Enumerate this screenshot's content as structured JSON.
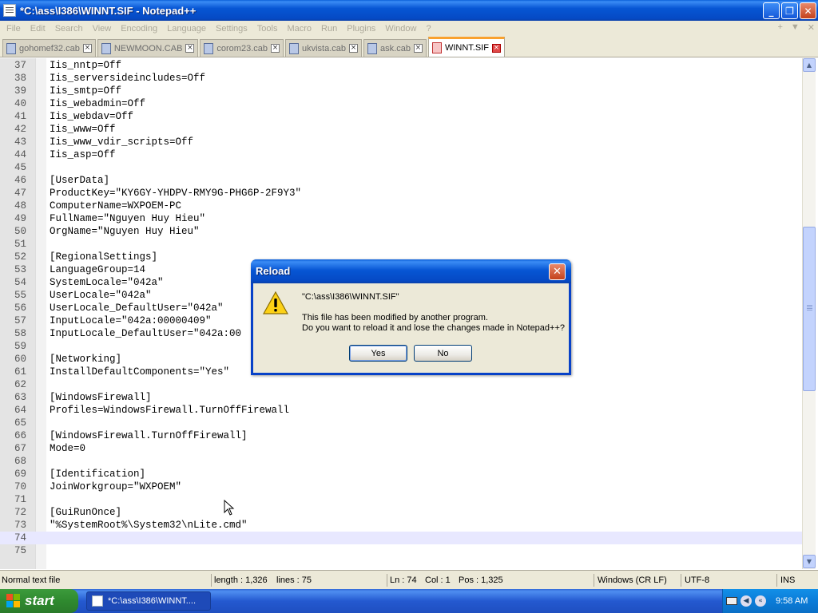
{
  "window": {
    "title": "*C:\\ass\\I386\\WINNT.SIF - Notepad++",
    "minimize_glyph": "_",
    "maximize_glyph": "❐",
    "close_glyph": "✕"
  },
  "menu": {
    "items": [
      "File",
      "Edit",
      "Search",
      "View",
      "Encoding",
      "Language",
      "Settings",
      "Tools",
      "Macro",
      "Run",
      "Plugins",
      "Window",
      "?"
    ],
    "right_controls": [
      "+",
      "▼",
      "✕"
    ]
  },
  "tabs": [
    {
      "label": "gohomef32.cab",
      "active": false
    },
    {
      "label": "NEWMOON.CAB",
      "active": false
    },
    {
      "label": "corom23.cab",
      "active": false
    },
    {
      "label": "ukvista.cab",
      "active": false
    },
    {
      "label": "ask.cab",
      "active": false
    },
    {
      "label": "WINNT.SIF",
      "active": true
    }
  ],
  "editor": {
    "current_line": 74,
    "lines": [
      {
        "n": "37",
        "t": "Iis_nntp=Off"
      },
      {
        "n": "38",
        "t": "Iis_serversideincludes=Off"
      },
      {
        "n": "39",
        "t": "Iis_smtp=Off"
      },
      {
        "n": "40",
        "t": "Iis_webadmin=Off"
      },
      {
        "n": "41",
        "t": "Iis_webdav=Off"
      },
      {
        "n": "42",
        "t": "Iis_www=Off"
      },
      {
        "n": "43",
        "t": "Iis_www_vdir_scripts=Off"
      },
      {
        "n": "44",
        "t": "Iis_asp=Off"
      },
      {
        "n": "45",
        "t": ""
      },
      {
        "n": "46",
        "t": "[UserData]"
      },
      {
        "n": "47",
        "t": "ProductKey=\"KY6GY-YHDPV-RMY9G-PHG6P-2F9Y3\""
      },
      {
        "n": "48",
        "t": "ComputerName=WXPOEM-PC"
      },
      {
        "n": "49",
        "t": "FullName=\"Nguyen Huy Hieu\""
      },
      {
        "n": "50",
        "t": "OrgName=\"Nguyen Huy Hieu\""
      },
      {
        "n": "51",
        "t": ""
      },
      {
        "n": "52",
        "t": "[RegionalSettings]"
      },
      {
        "n": "53",
        "t": "LanguageGroup=14"
      },
      {
        "n": "54",
        "t": "SystemLocale=\"042a\""
      },
      {
        "n": "55",
        "t": "UserLocale=\"042a\""
      },
      {
        "n": "56",
        "t": "UserLocale_DefaultUser=\"042a\""
      },
      {
        "n": "57",
        "t": "InputLocale=\"042a:00000409\""
      },
      {
        "n": "58",
        "t": "InputLocale_DefaultUser=\"042a:00"
      },
      {
        "n": "59",
        "t": ""
      },
      {
        "n": "60",
        "t": "[Networking]"
      },
      {
        "n": "61",
        "t": "InstallDefaultComponents=\"Yes\""
      },
      {
        "n": "62",
        "t": ""
      },
      {
        "n": "63",
        "t": "[WindowsFirewall]"
      },
      {
        "n": "64",
        "t": "Profiles=WindowsFirewall.TurnOffFirewall"
      },
      {
        "n": "65",
        "t": ""
      },
      {
        "n": "66",
        "t": "[WindowsFirewall.TurnOffFirewall]"
      },
      {
        "n": "67",
        "t": "Mode=0"
      },
      {
        "n": "68",
        "t": ""
      },
      {
        "n": "69",
        "t": "[Identification]"
      },
      {
        "n": "70",
        "t": "JoinWorkgroup=\"WXPOEM\""
      },
      {
        "n": "71",
        "t": ""
      },
      {
        "n": "72",
        "t": "[GuiRunOnce]"
      },
      {
        "n": "73",
        "t": "\"%SystemRoot%\\System32\\nLite.cmd\""
      },
      {
        "n": "74",
        "t": ""
      },
      {
        "n": "75",
        "t": ""
      }
    ]
  },
  "statusbar": {
    "file_type": "Normal text file",
    "length": "length : 1,326",
    "lines": "lines : 75",
    "ln": "Ln : 74",
    "col": "Col : 1",
    "pos": "Pos : 1,325",
    "eol": "Windows (CR LF)",
    "encoding": "UTF-8",
    "mode": "INS"
  },
  "dialog": {
    "title": "Reload",
    "icon": "warning-icon",
    "path": "\"C:\\ass\\I386\\WINNT.SIF\"",
    "line1": "This file has been modified by another program.",
    "line2": "Do you want to reload it and lose the changes made in Notepad++?",
    "yes_label": "Yes",
    "no_label": "No",
    "close_glyph": "✕"
  },
  "taskbar": {
    "start_label": "start",
    "task_label": "*C:\\ass\\I386\\WINNT....",
    "clock": "9:58 AM"
  },
  "colors": {
    "title_blue": "#0756d4",
    "active_tab_accent": "#f9a12e",
    "current_line_bg": "#e8e8ff",
    "start_green": "#2f8a2f"
  }
}
